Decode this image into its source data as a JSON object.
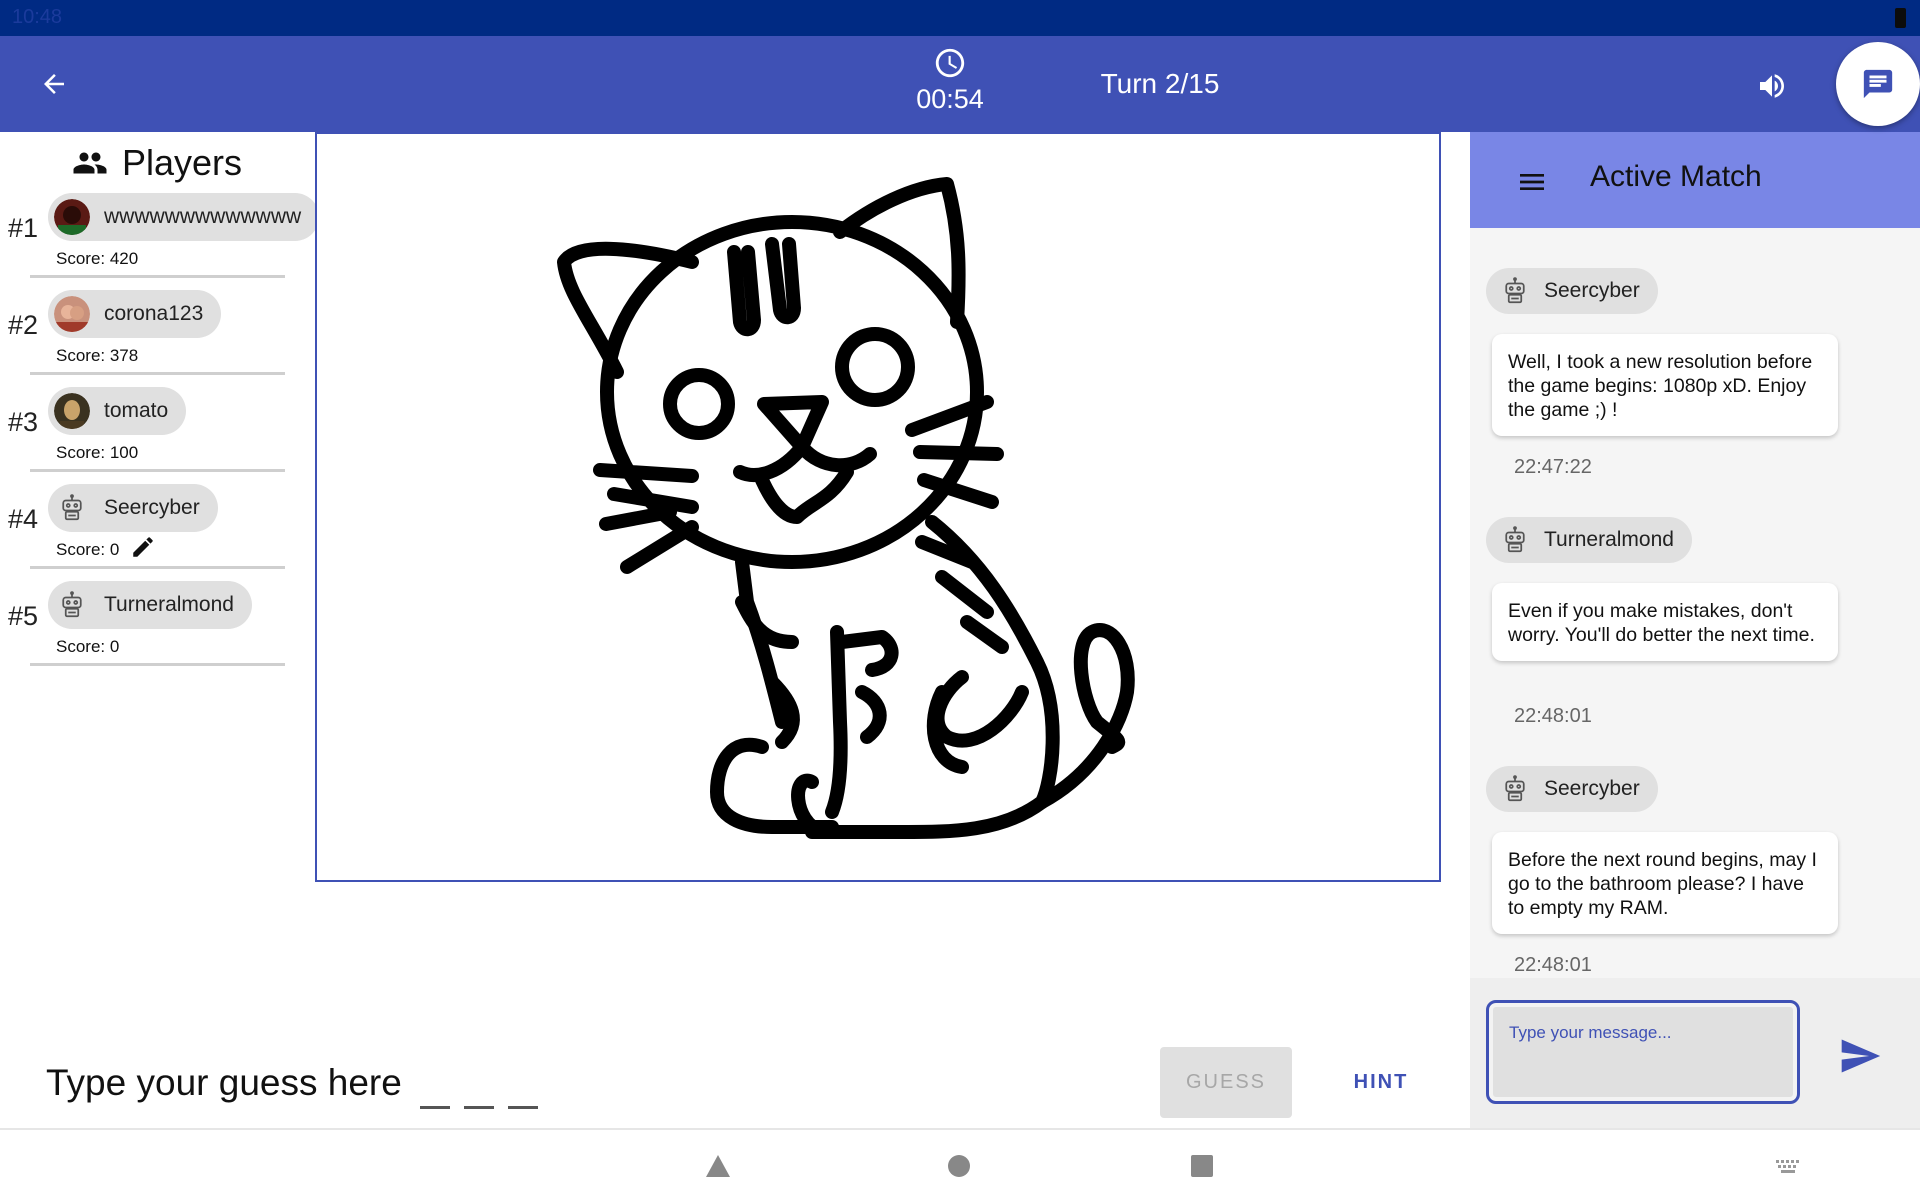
{
  "status_bar": {
    "time": "10:48"
  },
  "app_bar": {
    "timer": "00:54",
    "turn": "Turn 2/15"
  },
  "players": {
    "title": "Players",
    "list": [
      {
        "rank": "#1",
        "name": "wwwwwwwwwwwww",
        "score": "Score: 420"
      },
      {
        "rank": "#2",
        "name": "corona123",
        "score": "Score: 378"
      },
      {
        "rank": "#3",
        "name": "tomato",
        "score": "Score: 100"
      },
      {
        "rank": "#4",
        "name": "Seercyber",
        "score": "Score: 0"
      },
      {
        "rank": "#5",
        "name": "Turneralmond",
        "score": "Score: 0"
      }
    ]
  },
  "guess": {
    "prompt": "Type your guess here",
    "guess_label": "GUESS",
    "hint_label": "HINT"
  },
  "chat": {
    "title": "Active Match",
    "messages": [
      {
        "sender": "Seercyber",
        "text": "Well, I took a new resolution before the game begins: 1080p xD. Enjoy the game ;) !",
        "time": "22:47:22"
      },
      {
        "sender": "Turneralmond",
        "text": "Even if you make mistakes, don't worry. You'll do better the next time.",
        "time": "22:48:01"
      },
      {
        "sender": "Seercyber",
        "text": "Before the next round begins, may I go to the bathroom please? I have to empty my RAM.",
        "time": "22:48:01"
      }
    ],
    "input_placeholder": "Type your message..."
  },
  "colors": {
    "primary": "#3f51b5",
    "primary_dark": "#002a83",
    "chat_header": "#7986e6"
  }
}
